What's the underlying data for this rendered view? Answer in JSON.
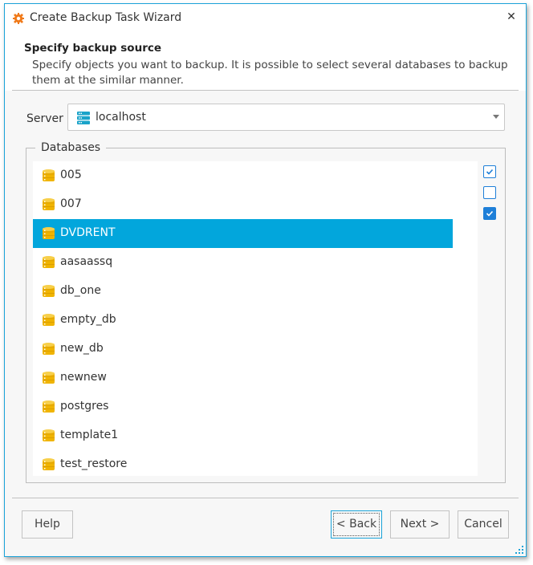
{
  "window": {
    "title": "Create Backup Task Wizard",
    "icon": "gear-icon",
    "close_icon": "close-icon",
    "close_glyph": "✕"
  },
  "header": {
    "title": "Specify backup source",
    "description": "Specify objects you want to backup. It is possible to select several databases to backup them at the similar manner."
  },
  "server": {
    "label": "Server",
    "value": "localhost",
    "icon": "server-icon"
  },
  "databases": {
    "group_label": "Databases",
    "selected_index": 2,
    "items": [
      {
        "name": "005"
      },
      {
        "name": "007"
      },
      {
        "name": "DVDRENT"
      },
      {
        "name": "aasaassq"
      },
      {
        "name": "db_one"
      },
      {
        "name": "empty_db"
      },
      {
        "name": "new_db"
      },
      {
        "name": "newnew"
      },
      {
        "name": "postgres"
      },
      {
        "name": "template1"
      },
      {
        "name": "test_restore"
      }
    ],
    "side_buttons": [
      "check-all",
      "uncheck-all",
      "check-selected"
    ]
  },
  "footer": {
    "help_label": "Help",
    "back_label": "< Back",
    "next_label": "Next >",
    "cancel_label": "Cancel"
  },
  "colors": {
    "accent": "#1aa3d9",
    "selection": "#02a6dc",
    "checkbox": "#1e7fd8",
    "db_icon": "#f0b400"
  }
}
